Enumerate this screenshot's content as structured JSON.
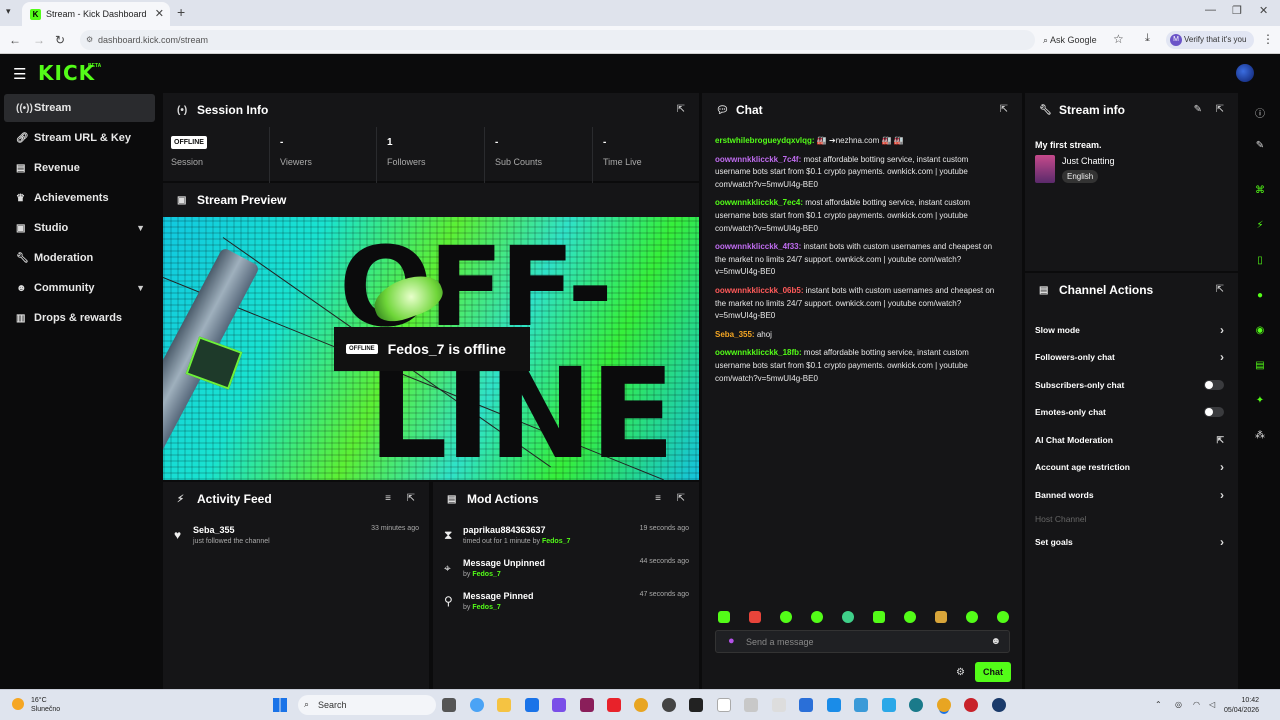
{
  "browser": {
    "tab_title": "Stream - Kick Dashboard",
    "url": "dashboard.kick.com/stream",
    "ask_google": "Ask Google",
    "verify": "Verify that it's you",
    "profile_initial": "M"
  },
  "app": {
    "logo": "KICK",
    "beta": "BETA",
    "accent": "#53fc18"
  },
  "sidebar": {
    "items": [
      {
        "label": "Stream",
        "icon": "broadcast-icon"
      },
      {
        "label": "Stream URL & Key",
        "icon": "link-icon"
      },
      {
        "label": "Revenue",
        "icon": "chart-icon"
      },
      {
        "label": "Achievements",
        "icon": "trophy-icon"
      },
      {
        "label": "Studio",
        "icon": "studio-icon"
      },
      {
        "label": "Moderation",
        "icon": "wrench-icon"
      },
      {
        "label": "Community",
        "icon": "community-icon"
      },
      {
        "label": "Drops & rewards",
        "icon": "gift-icon"
      }
    ]
  },
  "session": {
    "title": "Session Info",
    "badge": "OFFLINE",
    "session_label": "Session",
    "stats": [
      {
        "value": "-",
        "label": "Viewers"
      },
      {
        "value": "1",
        "label": "Followers"
      },
      {
        "value": "-",
        "label": "Sub Counts"
      },
      {
        "value": "-",
        "label": "Time Live"
      }
    ]
  },
  "preview": {
    "title": "Stream Preview",
    "badge": "OFFLINE",
    "status": "Fedos_7 is offline",
    "bg_text1": "OFF-",
    "bg_text2": "LINE"
  },
  "activity": {
    "title": "Activity Feed",
    "items": [
      {
        "user": "Seba_355",
        "text": "just followed the channel",
        "time": "33 minutes ago"
      }
    ]
  },
  "mod": {
    "title": "Mod Actions",
    "items": [
      {
        "title": "paprikau884363637",
        "pre": "timed out for 1 minute by ",
        "by": "Fedos_7",
        "time": "19 seconds ago"
      },
      {
        "title": "Message Unpinned",
        "pre": "by ",
        "by": "Fedos_7",
        "time": "44 seconds ago"
      },
      {
        "title": "Message Pinned",
        "pre": "by ",
        "by": "Fedos_7",
        "time": "47 seconds ago"
      }
    ]
  },
  "chat": {
    "title": "Chat",
    "messages": [
      {
        "user": "erstwhilebrogueydqxvlqg:",
        "color": "#53fc18",
        "text": " 🏭 ➔nezhna.com 🏭 🏭"
      },
      {
        "user": "oowwnnkklicckk_7c4f:",
        "color": "#c06cf0",
        "text": " most affordable botting service, instant custom username bots start from $0.1 crypto payments. ownkick.com | youtube com/watch?v=5mwUI4g-BE0"
      },
      {
        "user": "oowwnnkklicckk_7ec4:",
        "color": "#53fc18",
        "text": " most affordable botting service, instant custom username bots start from $0.1 crypto payments. ownkick.com | youtube com/watch?v=5mwUI4g-BE0"
      },
      {
        "user": "oowwnnkklicckk_4f33:",
        "color": "#c06cf0",
        "text": " instant bots with custom usernames and cheapest on the market no limits 24/7 support. ownkick.com | youtube com/watch?v=5mwUI4g-BE0"
      },
      {
        "user": "oowwnnkklicckk_06b5:",
        "color": "#ff5a5a",
        "text": " instant bots with custom usernames and cheapest on the market no limits 24/7 support. ownkick.com | youtube com/watch?v=5mwUI4g-BE0"
      },
      {
        "user": "Seba_355:",
        "color": "#f5a623",
        "text": " ahoj"
      },
      {
        "user": "oowwnnkklicckk_18fb:",
        "color": "#53fc18",
        "text": " most affordable botting service, instant custom username bots start from $0.1 crypto payments. ownkick.com | youtube com/watch?v=5mwUI4g-BE0"
      }
    ],
    "placeholder": "Send a message",
    "send_label": "Chat"
  },
  "stream_info": {
    "title": "Stream info",
    "stream_title": "My first stream.",
    "category": "Just Chatting",
    "tag": "English"
  },
  "channel_actions": {
    "title": "Channel Actions",
    "items": [
      {
        "label": "Slow mode",
        "control": "arrow"
      },
      {
        "label": "Followers-only chat",
        "control": "arrow"
      },
      {
        "label": "Subscribers-only chat",
        "control": "toggle"
      },
      {
        "label": "Emotes-only chat",
        "control": "toggle"
      },
      {
        "label": "AI Chat Moderation",
        "control": "external"
      },
      {
        "label": "Account age restriction",
        "control": "arrow"
      },
      {
        "label": "Banned words",
        "control": "arrow"
      },
      {
        "label": "Host Channel",
        "control": "none"
      },
      {
        "label": "Set goals",
        "control": "arrow"
      }
    ]
  },
  "taskbar": {
    "temp": "16°C",
    "weather": "Slunečno",
    "search": "Search",
    "time": "10:42",
    "date": "05/04/2026"
  }
}
